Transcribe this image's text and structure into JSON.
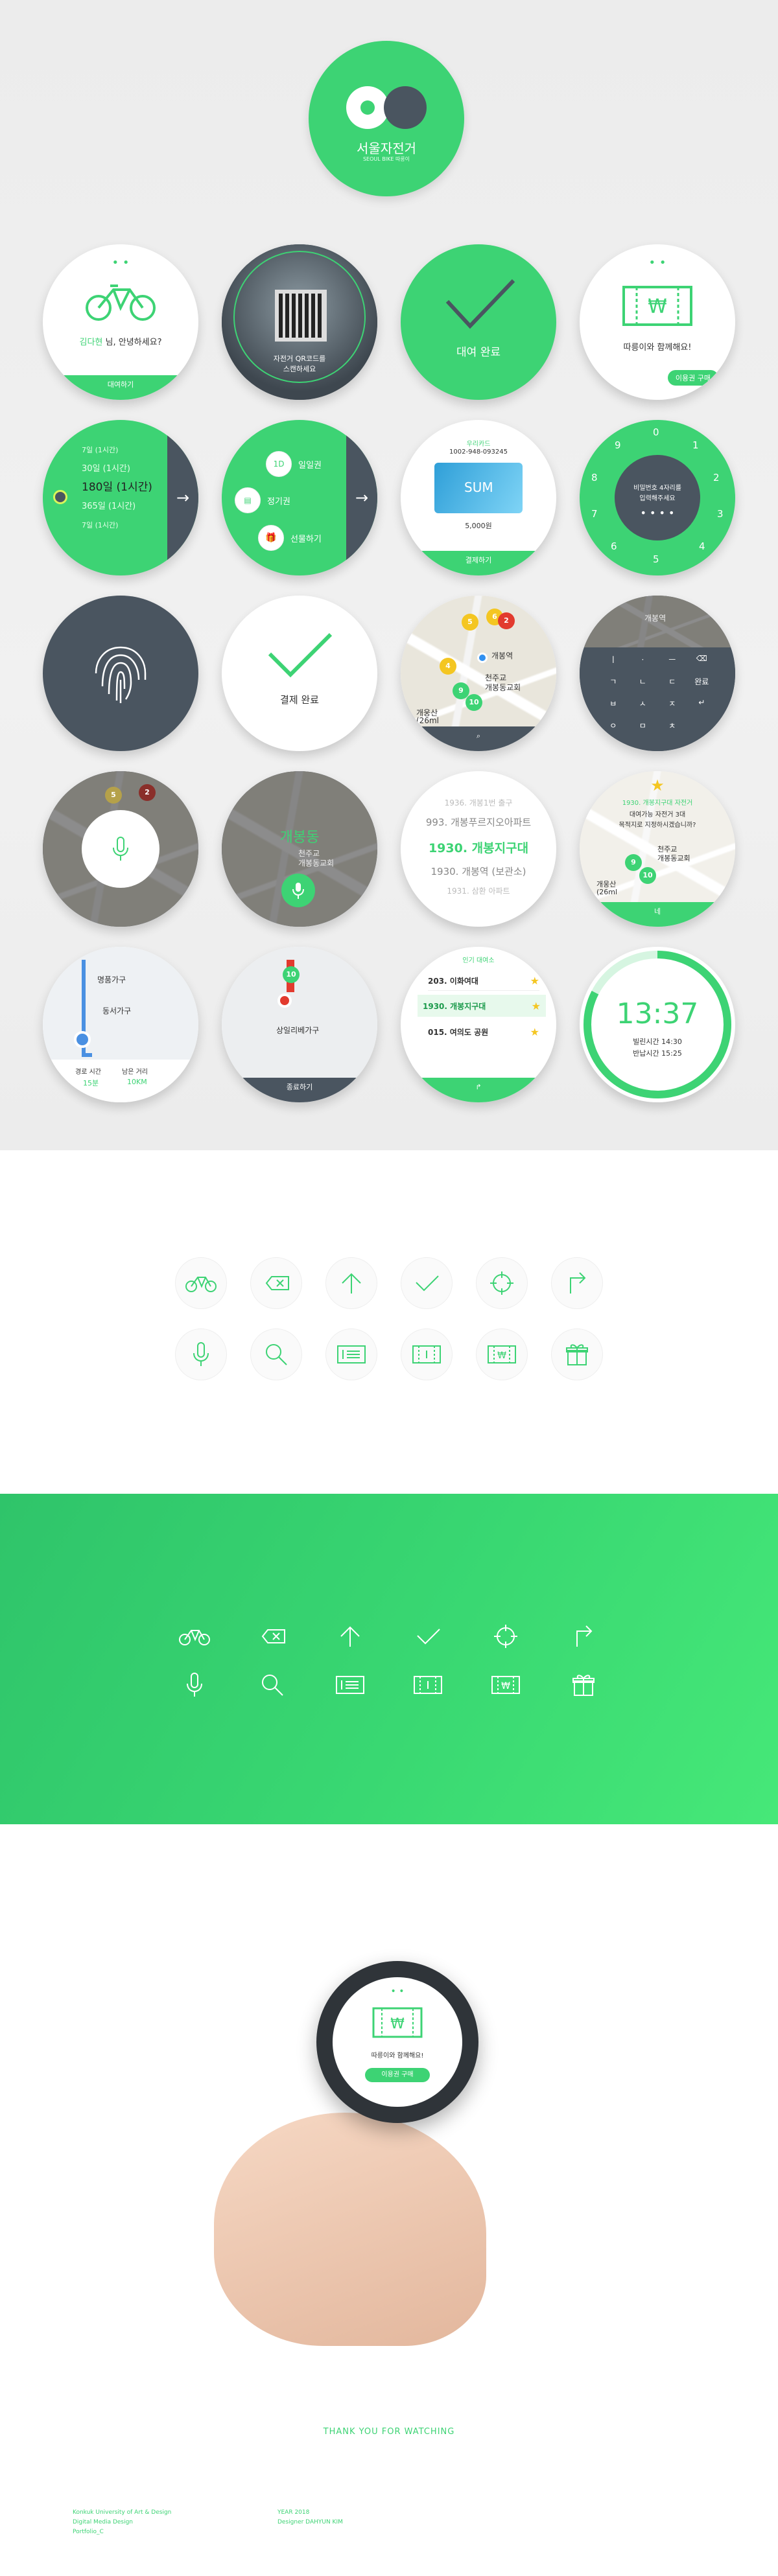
{
  "logo": {
    "title": "서울자전거",
    "subtitle": "SEOUL BIKE 따릉이"
  },
  "watches": {
    "greet": {
      "text_name": "김다현",
      "text_rest": " 님, 안녕하세요?",
      "button": "대여하기"
    },
    "qr": {
      "line1": "자전거 QR코드를",
      "line2": "스캔하세요"
    },
    "done": {
      "label": "대여 완료"
    },
    "ticket": {
      "text": "따릉이와 함께해요!",
      "button": "이용권 구매"
    },
    "period": {
      "items": [
        "7일 (1시간)",
        "30일 (1시간)",
        "180일 (1시간)",
        "365일 (1시간)",
        "7일 (1시간)"
      ]
    },
    "ticket_menu": {
      "items": [
        "일일권",
        "정기권",
        "선물하기"
      ]
    },
    "card": {
      "number": "1002-948-093245",
      "label": "우리카드",
      "brand": "SUM",
      "price": "5,000원",
      "button": "결제하기"
    },
    "keypad": {
      "digits": [
        "0",
        "1",
        "2",
        "3",
        "4",
        "5",
        "6",
        "7",
        "8",
        "9"
      ],
      "prompt_line1": "비밀번호 4자리를",
      "prompt_line2": "입력해주세요"
    },
    "payment": {
      "label": "결제 완료"
    },
    "map1": {
      "station": "개봉역",
      "church": "천주교",
      "church2": "개봉동교회",
      "hill": "개웅산",
      "height": "(26ml"
    },
    "map_dark": {
      "station": "개봉역",
      "ok": "완료"
    },
    "list_station": {
      "items": [
        "1936. 개봉1번 출구",
        "993. 개봉푸르지오아파트",
        "1930. 개봉지구대",
        "1930. 개봉역 (보관소)",
        "1931. 삼환 아파트"
      ]
    },
    "alert": {
      "title": "1930. 개봉지구대 자전거",
      "line1": "대여가능 자전거 3대",
      "line2": "목적지로 지정하시겠습니까?",
      "church": "천주교",
      "church2": "개봉동교회",
      "hill": "개웅산",
      "height": "(26ml",
      "button": "네"
    },
    "dark_voice": {
      "district": "개봉동",
      "church": "천주교",
      "church2": "개봉동교회"
    },
    "route": {
      "place1": "명품가구",
      "place2": "동서가구",
      "time_label": "경로 시간",
      "remain_label": "남은 거리",
      "time": "15분",
      "distance": "10KM"
    },
    "route2": {
      "place": "상일리베가구",
      "button": "종료하기"
    },
    "favorites": {
      "header": "인기 대여소",
      "items": [
        "203. 이화여대",
        "1930. 개봉지구대",
        "015. 여의도 공원"
      ]
    },
    "clock": {
      "time": "13:37",
      "rent_label": "빌린시간",
      "rent_time": "14:30",
      "return_label": "반납시간",
      "return_time": "15:25"
    }
  },
  "icons_row1": [
    "bike-icon",
    "delete-icon",
    "arrow-up-icon",
    "check-icon",
    "target-icon",
    "turn-right-icon"
  ],
  "icons_row2": [
    "mic-icon",
    "search-icon",
    "ticket-day-icon",
    "ticket-one-icon",
    "ticket-won-icon",
    "gift-icon"
  ],
  "photo": {
    "screen_text": "따릉이와 함께해요!",
    "screen_button": "이용권 구매"
  },
  "footer": {
    "thanks": "THANK YOU FOR WATCHING",
    "left": [
      "Konkuk University of Art & Design",
      "Digital Media Design",
      "Portfolio_C"
    ],
    "right": [
      "YEAR 2018",
      "Designer DAHYUN KIM"
    ]
  },
  "colors": {
    "green": "#3dd374",
    "dark": "#4a5560",
    "grey": "#ececec"
  }
}
